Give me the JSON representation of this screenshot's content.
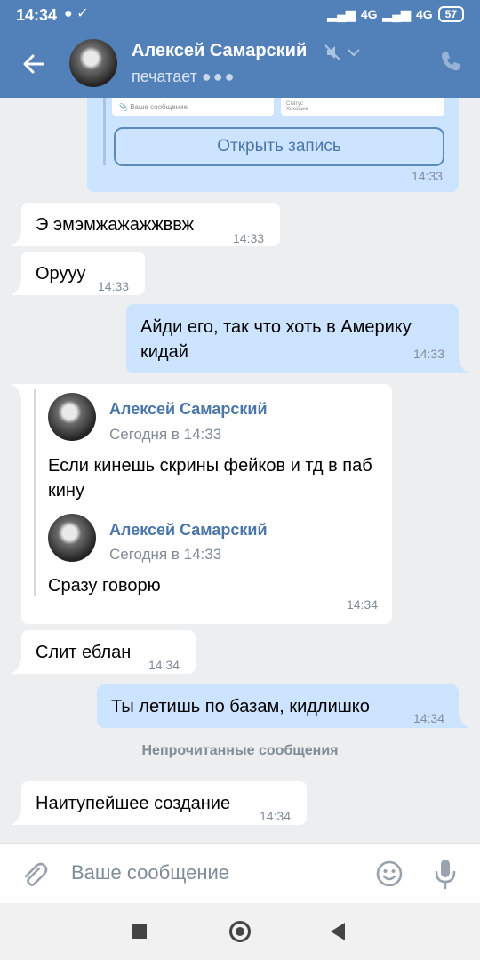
{
  "status_bar": {
    "time": "14:34",
    "network_1": "4G",
    "network_2": "4G",
    "battery": "57"
  },
  "header": {
    "contact_name": "Алексей Самарский",
    "typing_text": "печатает",
    "typing_dots": "●●●"
  },
  "card": {
    "mini_input_placeholder": "Ваше сообщение",
    "mini_status": "Статус",
    "mini_status_value": "Хохошик",
    "button_label": "Открыть запись",
    "time": "14:33"
  },
  "messages": [
    {
      "text": "Э эмэмжажажжввж",
      "time": "14:33",
      "dir": "in"
    },
    {
      "text": "Орууу",
      "time": "14:33",
      "dir": "in"
    },
    {
      "text": "Айди его, так что хоть в Америку кидай",
      "time": "14:33",
      "dir": "out"
    },
    {
      "text": "",
      "time": "14:34",
      "dir": "in"
    },
    {
      "text": "Слит еблан",
      "time": "14:34",
      "dir": "in"
    },
    {
      "text": "Ты летишь по базам, кидлишко",
      "time": "14:34",
      "dir": "out"
    },
    {
      "text": "Наитупейшее создание",
      "time": "14:34",
      "dir": "in"
    }
  ],
  "forwarded": [
    {
      "name": "Алексей Самарский",
      "date": "Сегодня в 14:33",
      "text": "Если кинешь скрины фейков и тд в паб кину"
    },
    {
      "name": "Алексей Самарский",
      "date": "Сегодня в 14:33",
      "text": "Сразу говорю"
    }
  ],
  "unread_separator": "Непрочитанные сообщения",
  "composer": {
    "placeholder": "Ваше сообщение"
  },
  "colors": {
    "header": "#5181b8",
    "outgoing_bubble": "#cce4ff",
    "incoming_bubble": "#ffffff",
    "background": "#edeef0",
    "link_blue": "#4a76a8"
  }
}
